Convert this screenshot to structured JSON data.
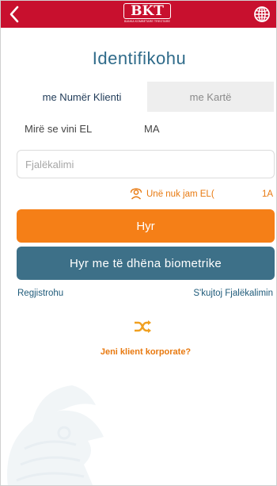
{
  "header": {
    "logo_text": "BKT",
    "logo_subtitle": "BANKA KOMBËTARE TREGTARE",
    "back_icon": "back-chevron-icon",
    "language_icon": "globe-icon"
  },
  "title": "Identifikohu",
  "tabs": [
    {
      "label": "me Numër Klienti",
      "active": true
    },
    {
      "label": "me Kartë",
      "active": false
    }
  ],
  "welcome": {
    "greeting": "Mirë se vini  EL",
    "name_suffix": "MA"
  },
  "password": {
    "placeholder": "Fjalëkalimi",
    "value": ""
  },
  "not_me": {
    "text": "Unë nuk jam EL(",
    "name_suffix": "1A",
    "icon": "phone-person-icon"
  },
  "buttons": {
    "login": "Hyr",
    "biometric": "Hyr me të dhëna biometrike"
  },
  "links": {
    "register": "Regjistrohu",
    "forgot_password": "S'kujtoj Fjalëkalimin"
  },
  "corporate": {
    "icon": "shuffle-icon",
    "text": "Jeni klient korporate?"
  },
  "colors": {
    "header": "#c8102e",
    "title": "#2f6b8a",
    "login_button": "#f57f17",
    "biometric_button": "#3d7088",
    "link": "#1f5b7a",
    "accent": "#e8790f"
  }
}
